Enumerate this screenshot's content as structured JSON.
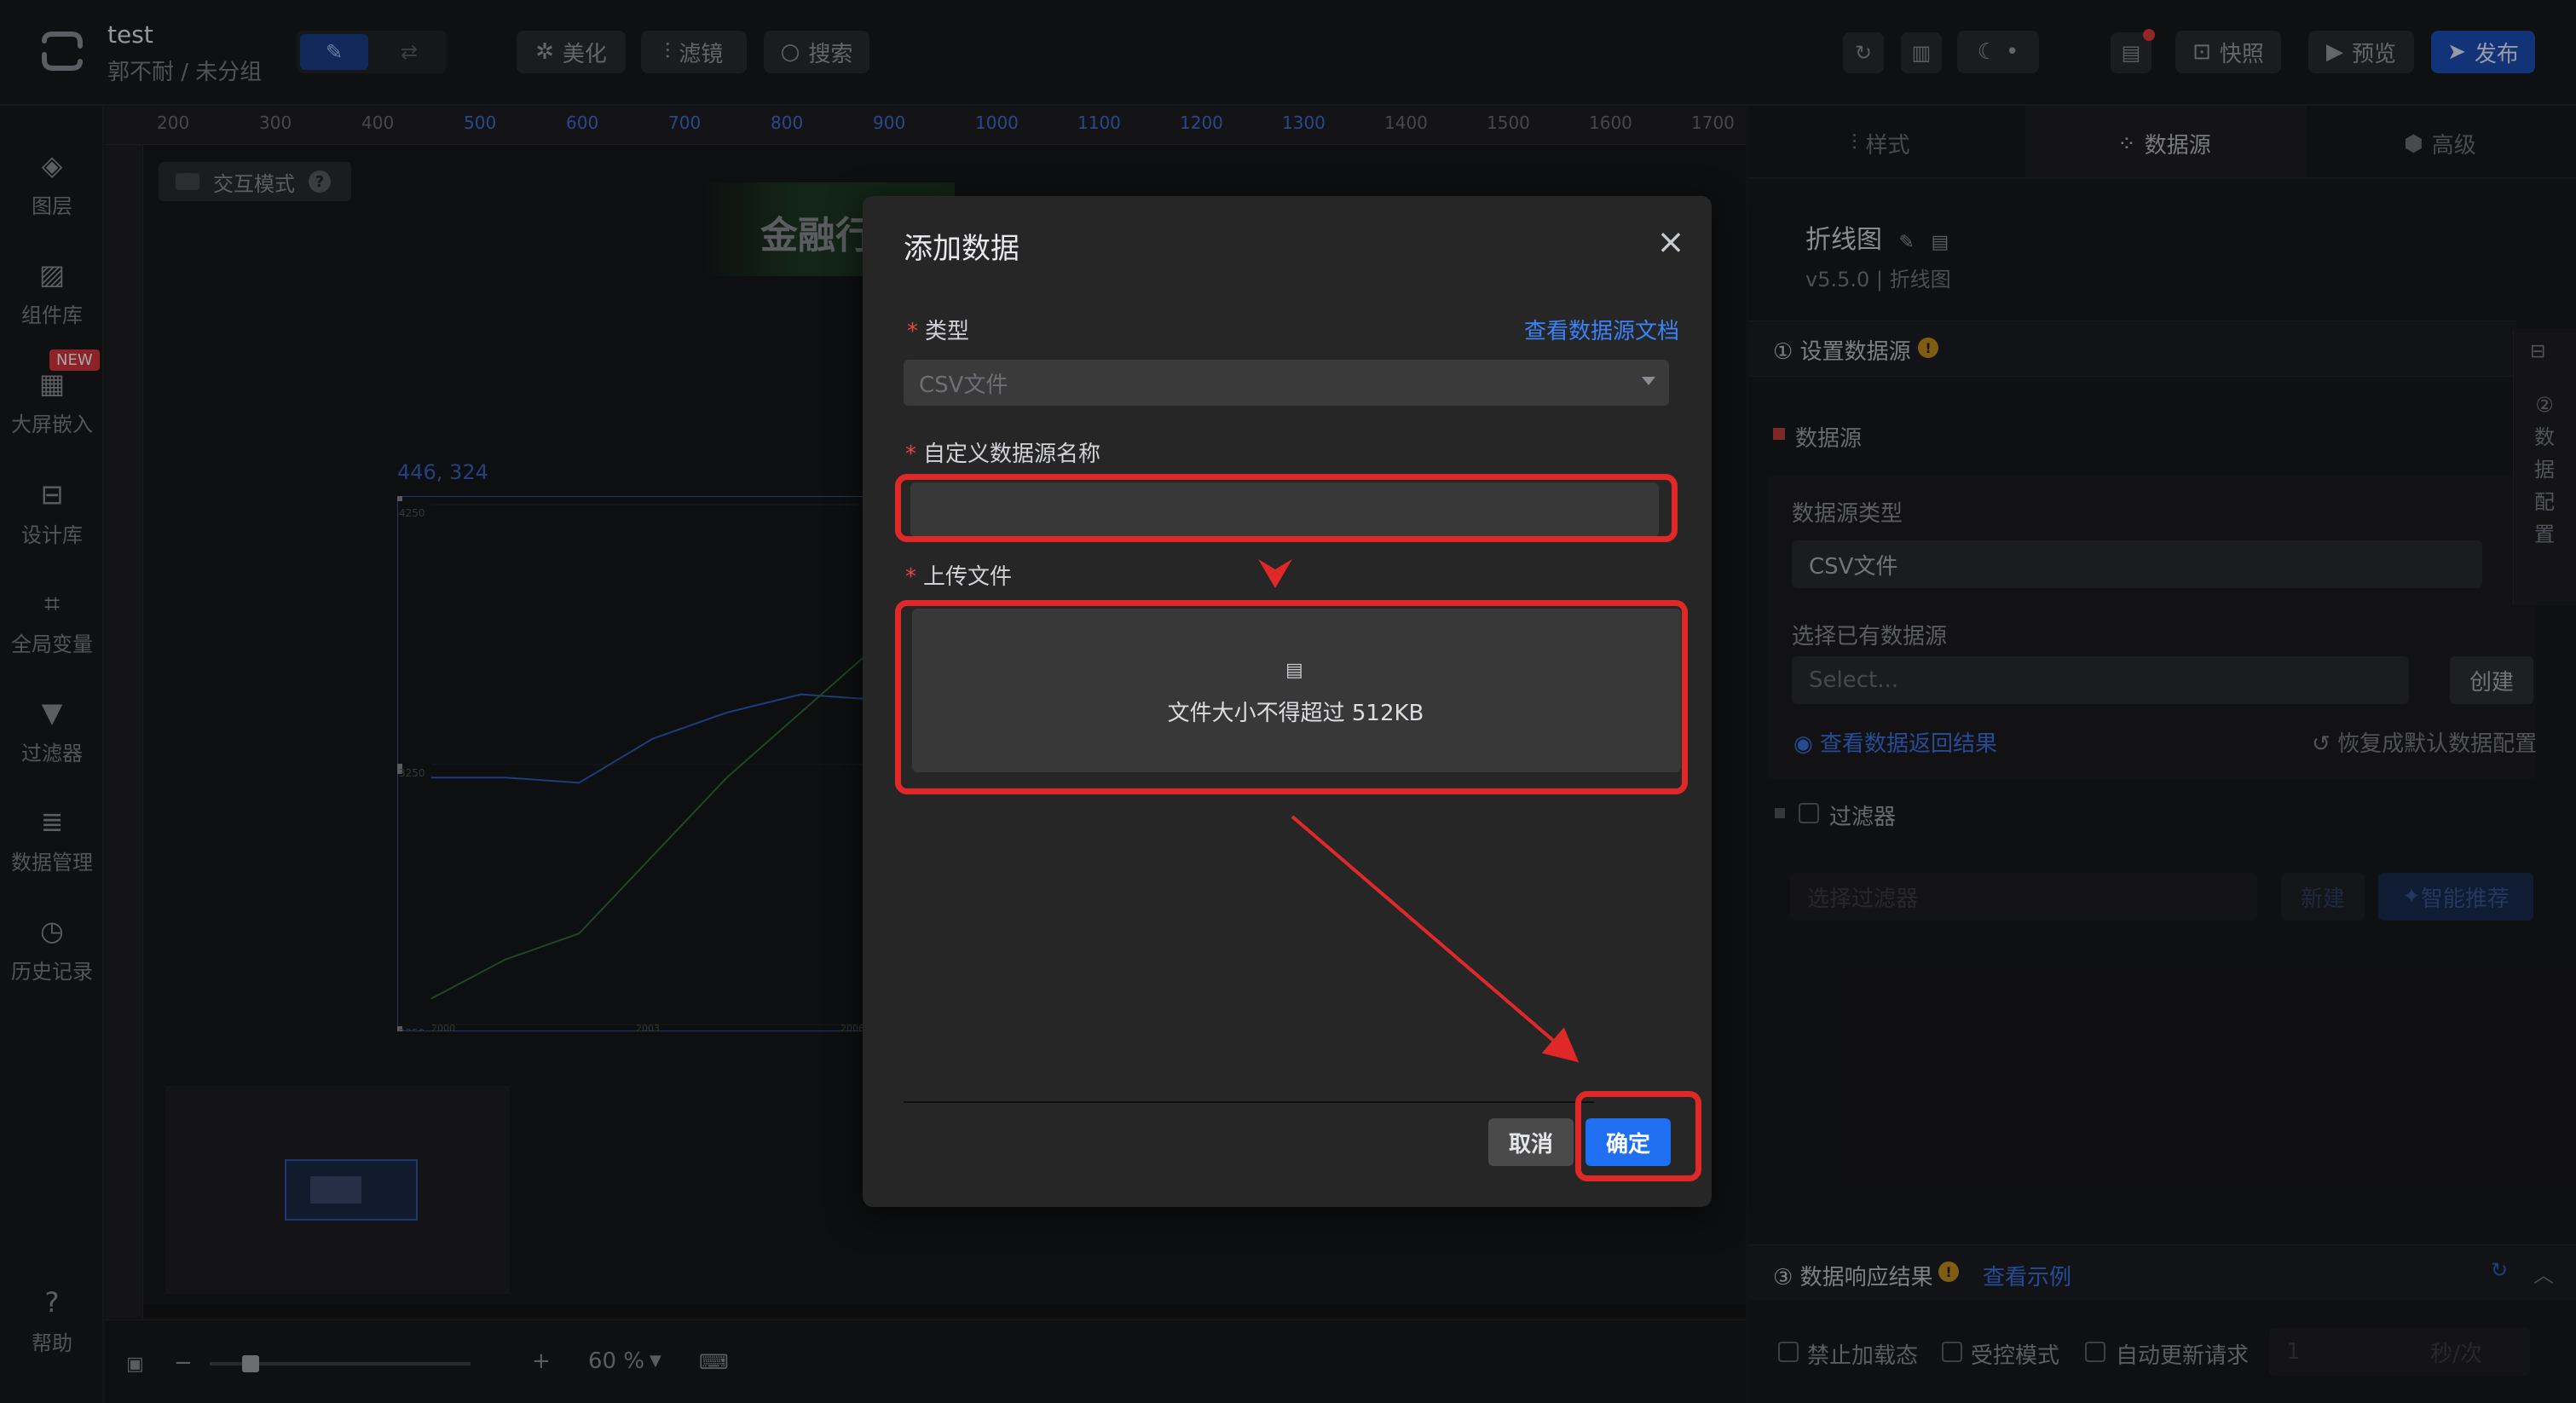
{
  "header": {
    "project_name": "test",
    "project_path": "郭不耐 / 未分组",
    "btn_beautify": "美化",
    "btn_filter": "滤镜",
    "btn_search": "搜索",
    "btn_snapshot": "快照",
    "btn_preview": "预览",
    "btn_publish": "发布"
  },
  "sidebar": {
    "items": [
      {
        "label": "图层"
      },
      {
        "label": "组件库"
      },
      {
        "label": "大屏嵌入"
      },
      {
        "label": "设计库"
      },
      {
        "label": "全局变量"
      },
      {
        "label": "过滤器"
      },
      {
        "label": "数据管理"
      },
      {
        "label": "历史记录"
      }
    ],
    "new_badge": "NEW",
    "help_label": "帮助"
  },
  "canvas": {
    "ruler_top": [
      "200",
      "300",
      "400",
      "500",
      "600",
      "700",
      "800",
      "900",
      "1000",
      "1100",
      "1200",
      "1300",
      "1400",
      "1500",
      "1600",
      "1700"
    ],
    "interaction_mode": "交互模式",
    "title_text": "金融行",
    "chart_coord": "446, 324",
    "zoom": "60 %"
  },
  "chart_data": {
    "type": "line",
    "title": "",
    "xlabel": "",
    "ylabel": "",
    "x": [
      "2000",
      "2003",
      "2006"
    ],
    "ylim": [
      2250,
      4250
    ],
    "yticks": [
      "4250",
      "3250",
      "2250"
    ],
    "series": [
      {
        "values": [
          3200,
          3200,
          3180,
          3350,
          3450,
          3520,
          3500
        ]
      },
      {
        "values": [
          2350,
          2500,
          2600,
          2900,
          3200,
          3450,
          3700
        ]
      }
    ],
    "colors": [
      "#2b5ebf",
      "#2f6e3a"
    ]
  },
  "right_panel": {
    "tabs": [
      "样式",
      "数据源",
      "高级"
    ],
    "active_tab": "数据源",
    "component_name": "折线图",
    "component_version": "v5.5.0 | 折线图",
    "section1_title": "① 设置数据源",
    "datasource_label": "数据源",
    "datasource_type_label": "数据源类型",
    "datasource_type_value": "CSV文件",
    "choose_existing_label": "选择已有数据源",
    "select_placeholder": "Select...",
    "create_btn": "创建",
    "view_result_link": "查看数据返回结果",
    "restore_link": "恢复成默认数据配置",
    "filter_label": "过滤器",
    "filter_select_placeholder": "选择过滤器",
    "new_btn": "新建",
    "smart_btn": "智能推荐",
    "vertical_tab": "② 数 据 配 置",
    "section3_title": "③ 数据响应结果",
    "view_example": "查看示例",
    "disable_loading": "禁止加载态",
    "controlled_mode": "受控模式",
    "auto_update": "自动更新请求",
    "interval_value": "1",
    "interval_unit": "秒/次"
  },
  "modal": {
    "title": "添加数据",
    "type_label": "类型",
    "doc_link": "查看数据源文档",
    "type_value": "CSV文件",
    "name_label": "自定义数据源名称",
    "name_value": "",
    "upload_label": "上传文件",
    "upload_hint": "文件大小不得超过 512KB",
    "cancel": "取消",
    "confirm": "确定"
  },
  "colors": {
    "accent_blue": "#1f6ff2",
    "annotation_red": "#e02828",
    "panel_bg": "#262626"
  }
}
